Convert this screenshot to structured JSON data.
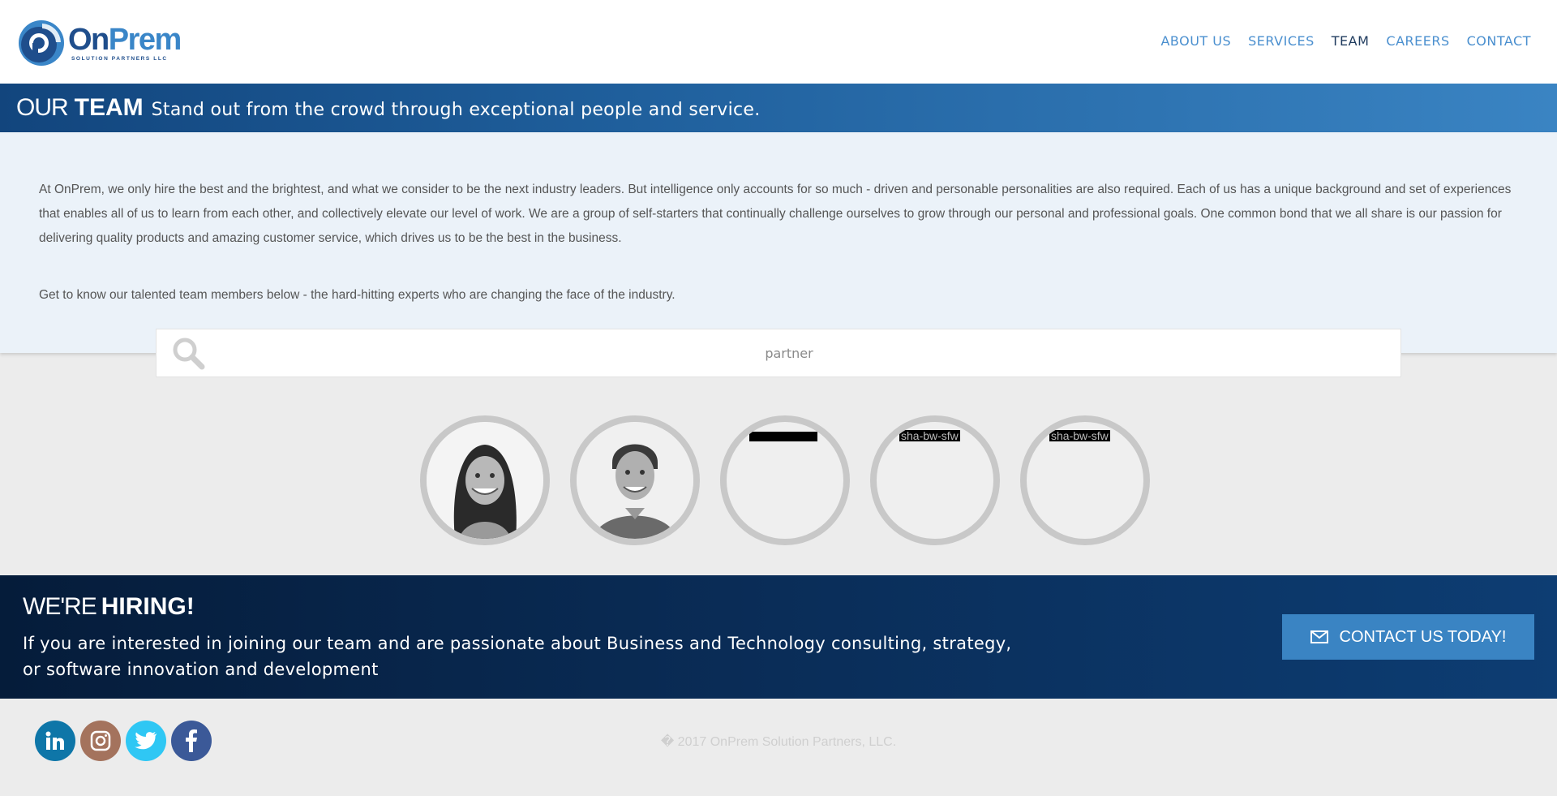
{
  "header": {
    "logo": {
      "name_part1": "On",
      "name_part2": "Prem",
      "subtitle": "SOLUTION PARTNERS LLC"
    },
    "nav": [
      {
        "label": "ABOUT US"
      },
      {
        "label": "SERVICES"
      },
      {
        "label": "TEAM",
        "active": true
      },
      {
        "label": "CAREERS"
      },
      {
        "label": "CONTACT"
      }
    ]
  },
  "banner": {
    "title_light": "OUR",
    "title_bold": "TEAM",
    "subtitle": "Stand out from the crowd through exceptional people and service."
  },
  "intro": {
    "paragraph1": "At OnPrem, we only hire the best and the brightest, and what we consider to be the next industry leaders. But intelligence only accounts for so much - driven and personable personalities are also required. Each of us has a unique background and set of experiences that enables all of us to learn from each other, and collectively elevate our level of work. We are a group of self-starters that continually challenge ourselves to grow through our personal and professional goals. One common bond that we all share is our passion for delivering quality products and amazing customer service, which drives us to be the best in the business.",
    "paragraph2": "Get to know our talented team members below - the hard-hitting experts who are changing the face of the industry."
  },
  "search": {
    "value": "partner"
  },
  "team": {
    "members": [
      {
        "type": "photo-woman"
      },
      {
        "type": "photo-man"
      },
      {
        "type": "broken",
        "alt": ""
      },
      {
        "type": "broken",
        "alt": "sha-bw-sfw"
      },
      {
        "type": "broken",
        "alt": "sha-bw-sfw"
      }
    ]
  },
  "hiring": {
    "title_light": "WE'RE",
    "title_bold": "HIRING!",
    "text": "If you are interested in joining our team and are passionate about Business and Technology consulting, strategy, or software innovation and development",
    "cta_label": "CONTACT US TODAY!"
  },
  "footer": {
    "social": [
      {
        "icon": "linkedin-icon",
        "color": "#0e76a8"
      },
      {
        "icon": "instagram-icon",
        "color": "#a4735d"
      },
      {
        "icon": "twitter-icon",
        "color": "#2fc7f4"
      },
      {
        "icon": "facebook-icon",
        "color": "#3b5998"
      }
    ],
    "copyright": "� 2017 OnPrem Solution Partners, LLC."
  },
  "colors": {
    "brand_dark": "#1f4e8c",
    "brand_light": "#3a86c8",
    "hiring_bg": "#0a2d58"
  }
}
